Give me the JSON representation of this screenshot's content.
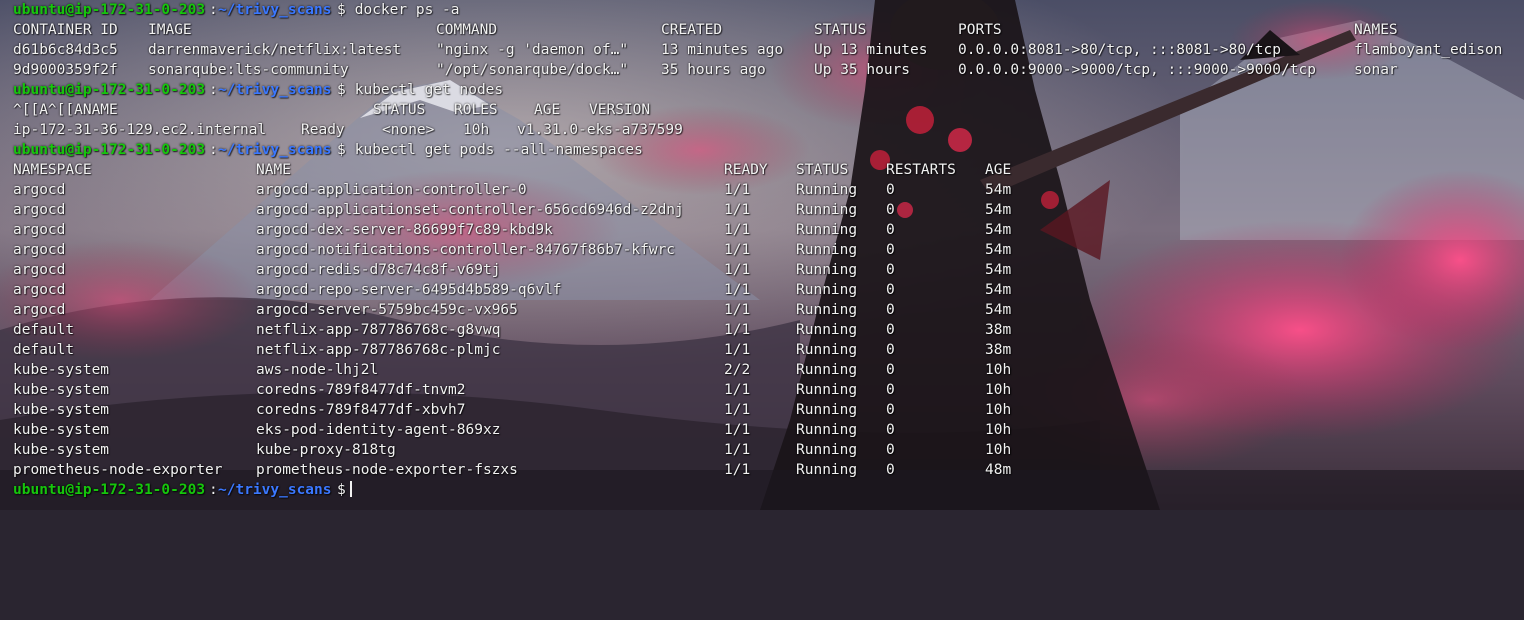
{
  "prompt": {
    "user_host": "ubuntu@ip-172-31-0-203",
    "sep": ":",
    "cwd": "~/trivy_scans",
    "symbol": "$"
  },
  "commands": {
    "docker": " docker ps -a",
    "nodes": " kubectl get nodes",
    "pods": " kubectl get pods --all-namespaces"
  },
  "docker": {
    "headers": [
      "CONTAINER ID",
      "IMAGE",
      "COMMAND",
      "CREATED",
      "STATUS",
      "PORTS",
      "NAMES"
    ],
    "rows": [
      [
        "d61b6c84d3c5",
        "darrenmaverick/netflix:latest",
        "\"nginx -g 'daemon of…\"",
        "13 minutes ago",
        "Up 13 minutes",
        "0.0.0.0:8081->80/tcp, :::8081->80/tcp",
        "flamboyant_edison"
      ],
      [
        "9d9000359f2f",
        "sonarqube:lts-community",
        "\"/opt/sonarqube/dock…\"",
        "35 hours ago",
        "Up 35 hours",
        "0.0.0.0:9000->9000/tcp, :::9000->9000/tcp",
        "sonar"
      ]
    ]
  },
  "nodes": {
    "headers": [
      "^[[A^[[ANAME",
      "STATUS",
      "ROLES",
      "AGE",
      "VERSION"
    ],
    "rows": [
      [
        "ip-172-31-36-129.ec2.internal",
        "Ready",
        "<none>",
        "10h",
        "v1.31.0-eks-a737599"
      ]
    ]
  },
  "pods": {
    "headers": [
      "NAMESPACE",
      "NAME",
      "READY",
      "STATUS",
      "RESTARTS",
      "AGE"
    ],
    "rows": [
      [
        "argocd",
        "argocd-application-controller-0",
        "1/1",
        "Running",
        "0",
        "54m"
      ],
      [
        "argocd",
        "argocd-applicationset-controller-656cd6946d-z2dnj",
        "1/1",
        "Running",
        "0",
        "54m"
      ],
      [
        "argocd",
        "argocd-dex-server-86699f7c89-kbd9k",
        "1/1",
        "Running",
        "0",
        "54m"
      ],
      [
        "argocd",
        "argocd-notifications-controller-84767f86b7-kfwrc",
        "1/1",
        "Running",
        "0",
        "54m"
      ],
      [
        "argocd",
        "argocd-redis-d78c74c8f-v69tj",
        "1/1",
        "Running",
        "0",
        "54m"
      ],
      [
        "argocd",
        "argocd-repo-server-6495d4b589-q6vlf",
        "1/1",
        "Running",
        "0",
        "54m"
      ],
      [
        "argocd",
        "argocd-server-5759bc459c-vx965",
        "1/1",
        "Running",
        "0",
        "54m"
      ],
      [
        "default",
        "netflix-app-787786768c-g8vwq",
        "1/1",
        "Running",
        "0",
        "38m"
      ],
      [
        "default",
        "netflix-app-787786768c-plmjc",
        "1/1",
        "Running",
        "0",
        "38m"
      ],
      [
        "kube-system",
        "aws-node-lhj2l",
        "2/2",
        "Running",
        "0",
        "10h"
      ],
      [
        "kube-system",
        "coredns-789f8477df-tnvm2",
        "1/1",
        "Running",
        "0",
        "10h"
      ],
      [
        "kube-system",
        "coredns-789f8477df-xbvh7",
        "1/1",
        "Running",
        "0",
        "10h"
      ],
      [
        "kube-system",
        "eks-pod-identity-agent-869xz",
        "1/1",
        "Running",
        "0",
        "10h"
      ],
      [
        "kube-system",
        "kube-proxy-818tg",
        "1/1",
        "Running",
        "0",
        "10h"
      ],
      [
        "prometheus-node-exporter",
        "prometheus-node-exporter-fszxs",
        "1/1",
        "Running",
        "0",
        "48m"
      ]
    ]
  },
  "colors": {
    "prompt_user": "#16c60c",
    "prompt_path": "#3b78ff",
    "text": "#f2f2f2"
  }
}
